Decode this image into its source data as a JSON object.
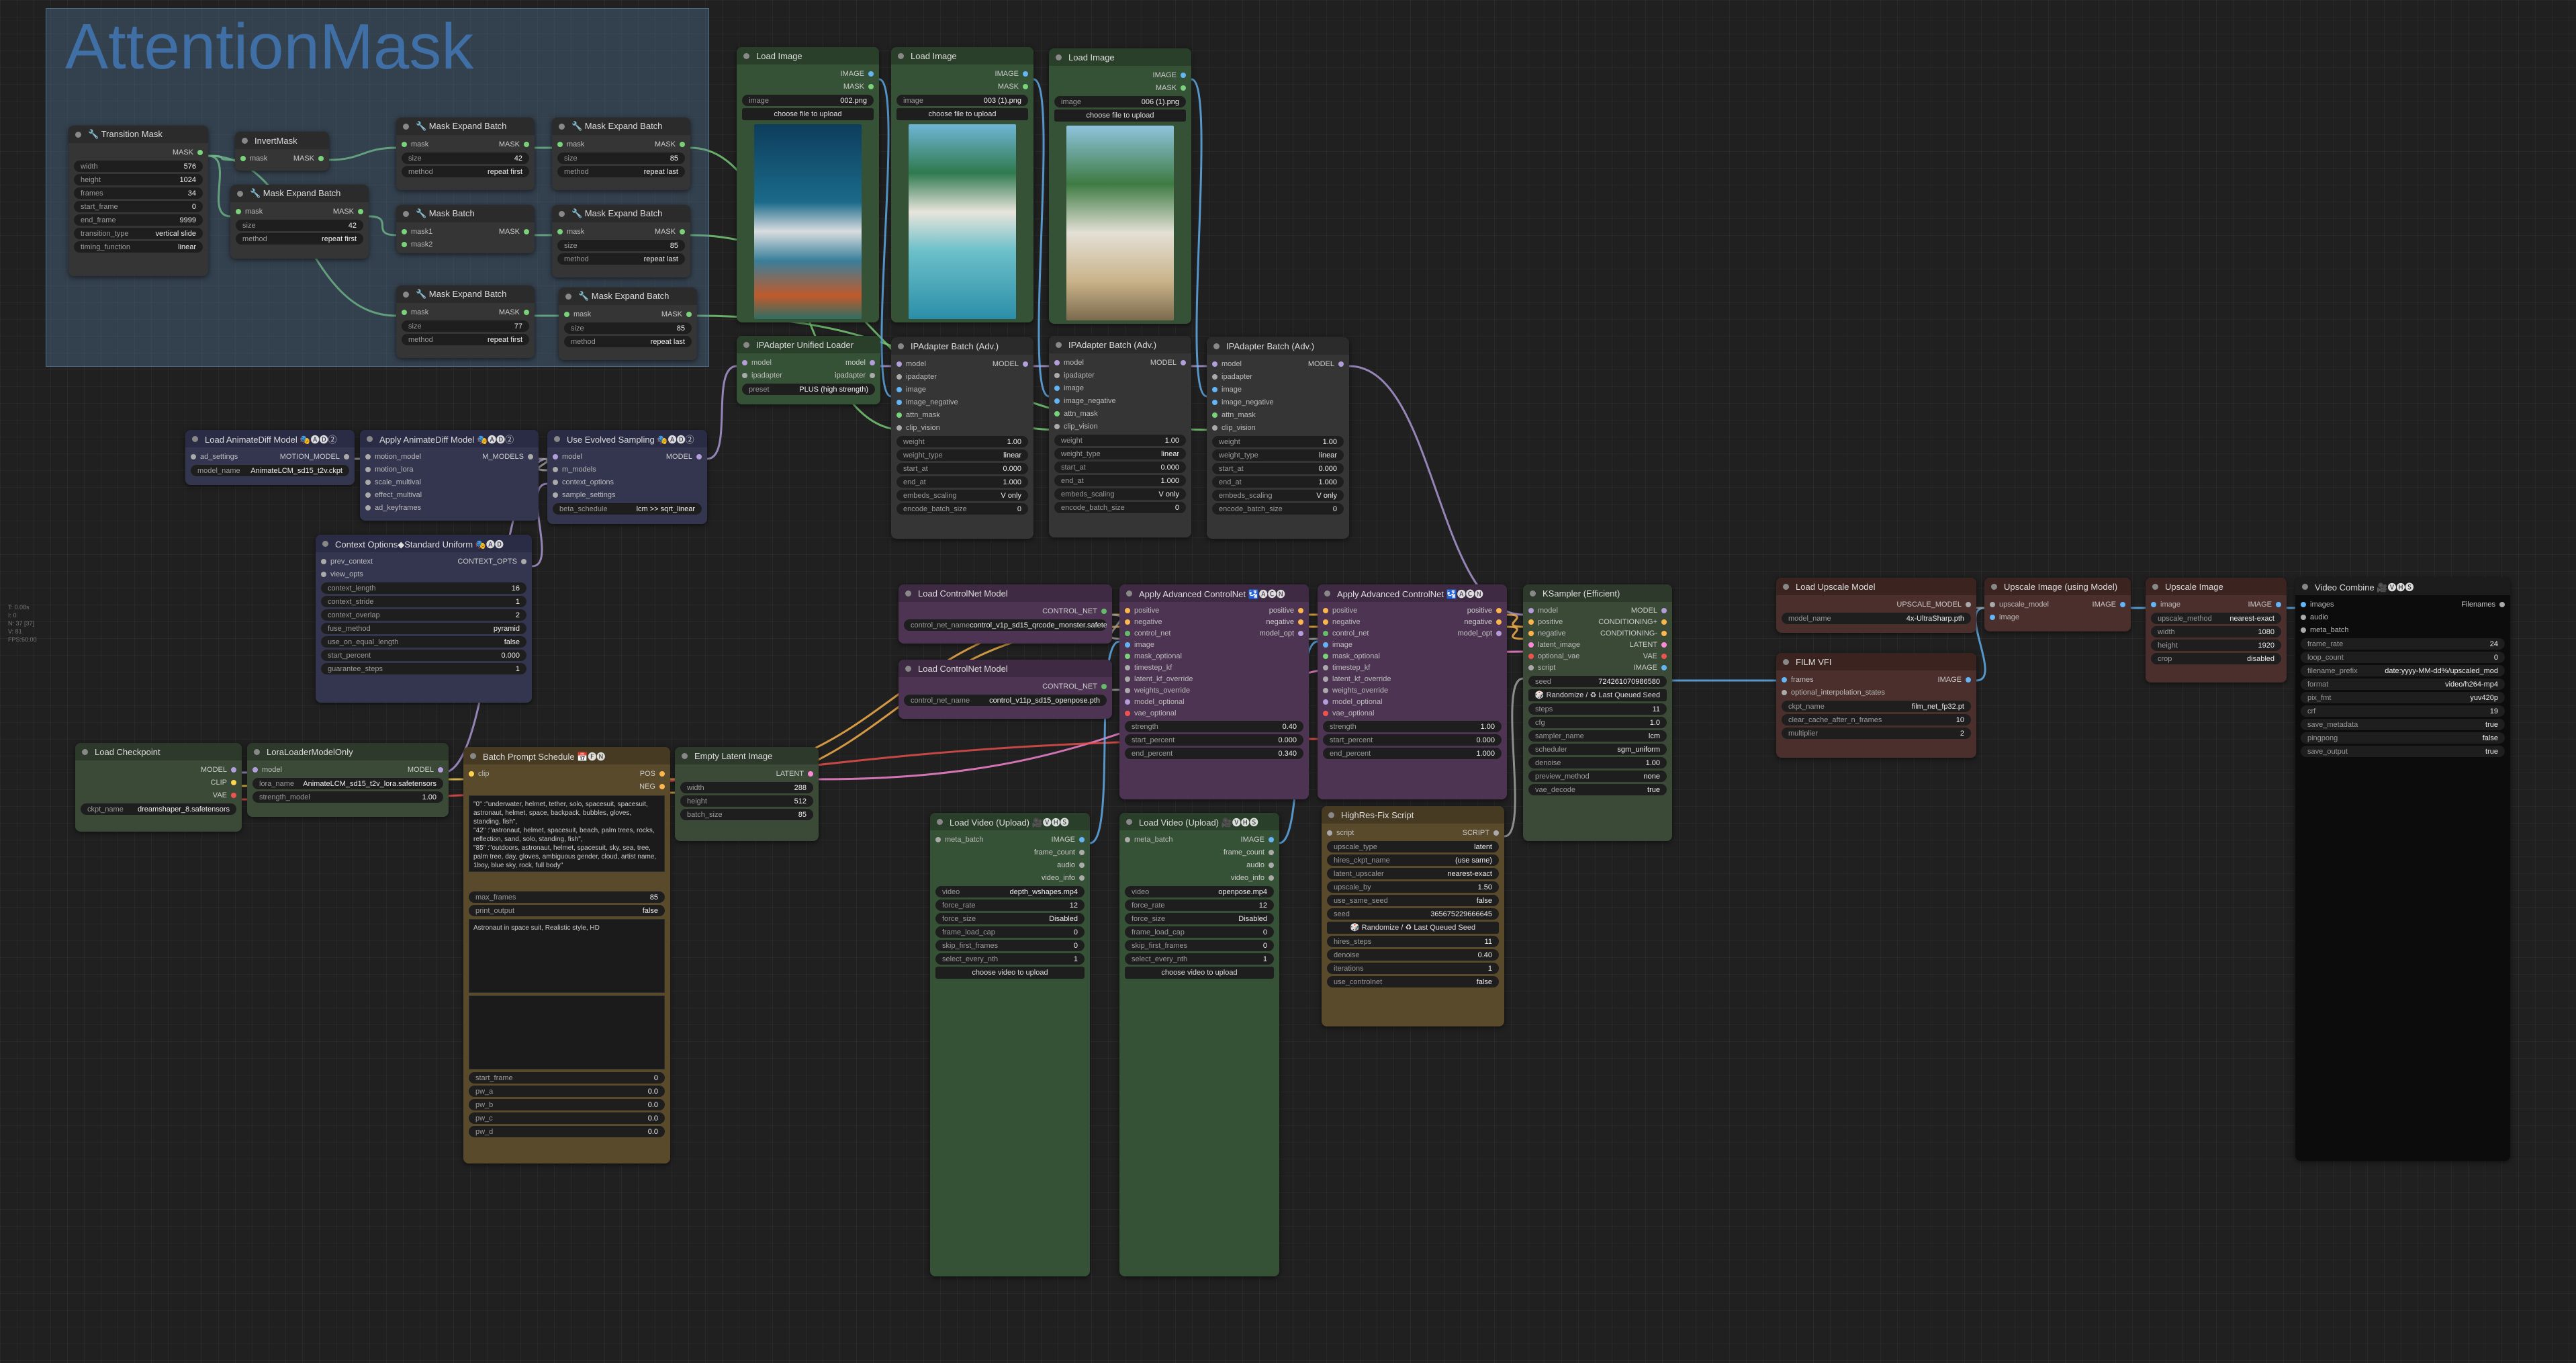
{
  "group": {
    "title": "AttentionMask"
  },
  "colors": {
    "mask_link": "#7ad27a",
    "model_link": "#b39ddb",
    "image_link": "#64b5f6",
    "cond_link": "#ffb74d",
    "latent_link": "#ff8ad8",
    "clip_link": "#ffd54f",
    "vae_link": "#ef5350"
  },
  "nodes": {
    "transition_mask": {
      "title": "🔧 Transition Mask",
      "out": "MASK",
      "w": [
        [
          "width",
          "576"
        ],
        [
          "height",
          "1024"
        ],
        [
          "frames",
          "34"
        ],
        [
          "start_frame",
          "0"
        ],
        [
          "end_frame",
          "9999"
        ],
        [
          "transition_type",
          "vertical slide"
        ],
        [
          "timing_function",
          "linear"
        ]
      ]
    },
    "invert_mask": {
      "title": "InvertMask",
      "in": "mask",
      "out": "MASK"
    },
    "meb_mid": {
      "title": "🔧 Mask Expand Batch",
      "in": "mask",
      "out": "MASK",
      "w": [
        [
          "size",
          "42"
        ],
        [
          "method",
          "repeat first"
        ]
      ]
    },
    "meb_1": {
      "title": "🔧 Mask Expand Batch",
      "in": "mask",
      "out": "MASK",
      "w": [
        [
          "size",
          "42"
        ],
        [
          "method",
          "repeat first"
        ]
      ]
    },
    "meb_2": {
      "title": "🔧 Mask Expand Batch",
      "in": "mask",
      "out": "MASK",
      "w": [
        [
          "size",
          "85"
        ],
        [
          "method",
          "repeat last"
        ]
      ]
    },
    "mask_batch": {
      "title": "🔧 Mask Batch",
      "in1": "mask1",
      "in2": "mask2",
      "out": "MASK"
    },
    "meb_3": {
      "title": "🔧 Mask Expand Batch",
      "in": "mask",
      "out": "MASK",
      "w": [
        [
          "size",
          "85"
        ],
        [
          "method",
          "repeat last"
        ]
      ]
    },
    "meb_4": {
      "title": "🔧 Mask Expand Batch",
      "in": "mask",
      "out": "MASK",
      "w": [
        [
          "size",
          "77"
        ],
        [
          "method",
          "repeat first"
        ]
      ]
    },
    "meb_5": {
      "title": "🔧 Mask Expand Batch",
      "in": "mask",
      "out": "MASK",
      "w": [
        [
          "size",
          "85"
        ],
        [
          "method",
          "repeat last"
        ]
      ]
    },
    "load_image_1": {
      "title": "Load Image",
      "o1": "IMAGE",
      "o2": "MASK",
      "image": "002.png",
      "upload": "choose file to upload"
    },
    "load_image_2": {
      "title": "Load Image",
      "o1": "IMAGE",
      "o2": "MASK",
      "image": "003 (1).png",
      "upload": "choose file to upload"
    },
    "load_image_3": {
      "title": "Load Image",
      "o1": "IMAGE",
      "o2": "MASK",
      "image": "006 (1).png",
      "upload": "choose file to upload"
    },
    "ipa_loader": {
      "title": "IPAdapter Unified Loader",
      "in1": "model",
      "in2": "ipadapter",
      "o1": "model",
      "o2": "ipadapter",
      "w": [
        [
          "preset",
          "PLUS (high strength)"
        ]
      ]
    },
    "ipa_batch": {
      "title": "IPAdapter Batch (Adv.)",
      "ins": [
        "model",
        "ipadapter",
        "image",
        "image_negative",
        "attn_mask",
        "clip_vision"
      ],
      "out": "MODEL",
      "w": [
        [
          "weight",
          "1.00"
        ],
        [
          "weight_type",
          "linear"
        ],
        [
          "start_at",
          "0.000"
        ],
        [
          "end_at",
          "1.000"
        ],
        [
          "embeds_scaling",
          "V only"
        ],
        [
          "encode_batch_size",
          "0"
        ]
      ]
    },
    "load_animatediff": {
      "title": "Load AnimateDiff Model 🎭🅐🅓②",
      "in": "ad_settings",
      "out": "MOTION_MODEL",
      "w": [
        [
          "model_name",
          "AnimateLCM_sd15_t2v.ckpt"
        ]
      ]
    },
    "apply_animatediff": {
      "title": "Apply AnimateDiff Model 🎭🅐🅓②",
      "ins": [
        "motion_model",
        "motion_lora",
        "scale_multival",
        "effect_multival",
        "ad_keyframes"
      ],
      "out": "M_MODELS"
    },
    "evolved_sampling": {
      "title": "Use Evolved Sampling 🎭🅐🅓②",
      "ins": [
        "model",
        "m_models",
        "context_options",
        "sample_settings"
      ],
      "out": "MODEL",
      "w": [
        [
          "beta_schedule",
          "lcm >> sqrt_linear"
        ]
      ]
    },
    "context_options": {
      "title": "Context Options◆Standard Uniform 🎭🅐🅓",
      "ins": [
        "prev_context",
        "view_opts"
      ],
      "out": "CONTEXT_OPTS",
      "w": [
        [
          "context_length",
          "16"
        ],
        [
          "context_stride",
          "1"
        ],
        [
          "context_overlap",
          "2"
        ],
        [
          "fuse_method",
          "pyramid"
        ],
        [
          "use_on_equal_length",
          "false"
        ],
        [
          "start_percent",
          "0.000"
        ],
        [
          "guarantee_steps",
          "1"
        ]
      ]
    },
    "load_checkpoint": {
      "title": "Load Checkpoint",
      "outs": [
        "MODEL",
        "CLIP",
        "VAE"
      ],
      "w": [
        [
          "ckpt_name",
          "dreamshaper_8.safetensors"
        ]
      ]
    },
    "lora_loader": {
      "title": "LoraLoaderModelOnly",
      "in": "model",
      "out": "MODEL",
      "w": [
        [
          "lora_name",
          "AnimateLCM_sd15_t2v_lora.safetensors"
        ],
        [
          "strength_model",
          "1.00"
        ]
      ]
    },
    "batch_prompt": {
      "title": "Batch Prompt Schedule 📅🅕🅝",
      "in": "clip",
      "o1": "POS",
      "o2": "NEG",
      "text": "\"0\" :\"underwater, helmet, tether, solo, spacesuit, spacesuit, astronaut, helmet, space, backpack, bubbles, gloves, standing, fish\",\n\"42\" :\"astronaut, helmet, spacesuit, beach, palm trees, rocks, reflection, sand, solo, standing, fish\",\n\"85\" :\"outdoors, astronaut, helmet, spacesuit, sky, sea, tree, palm tree, day, gloves, ambiguous gender, cloud, artist name, 1boy, blue sky, rock, full body\"",
      "w1": [
        [
          "max_frames",
          "85"
        ],
        [
          "print_output",
          "false"
        ]
      ],
      "pre_text": "Astronaut in space suit, Realistic style, HD",
      "w2": [
        [
          "start_frame",
          "0"
        ],
        [
          "pw_a",
          "0.0"
        ],
        [
          "pw_b",
          "0.0"
        ],
        [
          "pw_c",
          "0.0"
        ],
        [
          "pw_d",
          "0.0"
        ]
      ]
    },
    "empty_latent": {
      "title": "Empty Latent Image",
      "out": "LATENT",
      "w": [
        [
          "width",
          "288"
        ],
        [
          "height",
          "512"
        ],
        [
          "batch_size",
          "85"
        ]
      ]
    },
    "cn_loader_1": {
      "title": "Load ControlNet Model",
      "out": "CONTROL_NET",
      "w": [
        [
          "control_net_name",
          "control_v1p_sd15_qrcode_monster.safetensors"
        ]
      ]
    },
    "cn_loader_2": {
      "title": "Load ControlNet Model",
      "out": "CONTROL_NET",
      "w": [
        [
          "control_net_name",
          "control_v11p_sd15_openpose.pth"
        ]
      ]
    },
    "adv_cn_1": {
      "title": "Apply Advanced ControlNet 🛂🅐🅒🅝",
      "ins": [
        "positive",
        "negative",
        "control_net",
        "image",
        "mask_optional",
        "timestep_kf",
        "latent_kf_override",
        "weights_override",
        "model_optional",
        "vae_optional"
      ],
      "outs": [
        "positive",
        "negative",
        "model_opt"
      ],
      "w": [
        [
          "strength",
          "0.40"
        ],
        [
          "start_percent",
          "0.000"
        ],
        [
          "end_percent",
          "0.340"
        ]
      ]
    },
    "adv_cn_2": {
      "title": "Apply Advanced ControlNet 🛂🅐🅒🅝",
      "ins": [
        "positive",
        "negative",
        "control_net",
        "image",
        "mask_optional",
        "timestep_kf",
        "latent_kf_override",
        "weights_override",
        "model_optional",
        "vae_optional"
      ],
      "outs": [
        "positive",
        "negative",
        "model_opt"
      ],
      "w": [
        [
          "strength",
          "1.00"
        ],
        [
          "start_percent",
          "0.000"
        ],
        [
          "end_percent",
          "1.000"
        ]
      ]
    },
    "ksampler": {
      "title": "KSampler (Efficient)",
      "ins": [
        "model",
        "positive",
        "negative",
        "latent_image",
        "optional_vae",
        "script"
      ],
      "outs": [
        "MODEL",
        "CONDITIONING+",
        "CONDITIONING-",
        "LATENT",
        "VAE",
        "IMAGE"
      ],
      "seed": [
        "seed",
        "724261070986580"
      ],
      "seed_btn": "🎲 Randomize / ♻ Last Queued Seed",
      "w": [
        [
          "steps",
          "11"
        ],
        [
          "cfg",
          "1.0"
        ],
        [
          "sampler_name",
          "lcm"
        ],
        [
          "scheduler",
          "sgm_uniform"
        ],
        [
          "denoise",
          "1.00"
        ],
        [
          "preview_method",
          "none"
        ],
        [
          "vae_decode",
          "true"
        ]
      ]
    },
    "video_1": {
      "title": "Load Video (Upload) 🎥🅥🅗🅢",
      "in": "meta_batch",
      "outs": [
        "IMAGE",
        "frame_count",
        "audio",
        "video_info"
      ],
      "w": [
        [
          "video",
          "depth_wshapes.mp4"
        ],
        [
          "force_rate",
          "12"
        ],
        [
          "force_size",
          "Disabled"
        ],
        [
          "frame_load_cap",
          "0"
        ],
        [
          "skip_first_frames",
          "0"
        ],
        [
          "select_every_nth",
          "1"
        ]
      ],
      "upload": "choose video to upload"
    },
    "video_2": {
      "title": "Load Video (Upload) 🎥🅥🅗🅢",
      "in": "meta_batch",
      "outs": [
        "IMAGE",
        "frame_count",
        "audio",
        "video_info"
      ],
      "w": [
        [
          "video",
          "openpose.mp4"
        ],
        [
          "force_rate",
          "12"
        ],
        [
          "force_size",
          "Disabled"
        ],
        [
          "frame_load_cap",
          "0"
        ],
        [
          "skip_first_frames",
          "0"
        ],
        [
          "select_every_nth",
          "1"
        ]
      ],
      "upload": "choose video to upload"
    },
    "hires": {
      "title": "HighRes-Fix Script",
      "in": "script",
      "out": "SCRIPT",
      "w1": [
        [
          "upscale_type",
          "latent"
        ],
        [
          "hires_ckpt_name",
          "(use same)"
        ],
        [
          "latent_upscaler",
          "nearest-exact"
        ],
        [
          "upscale_by",
          "1.50"
        ],
        [
          "use_same_seed",
          "false"
        ],
        [
          "seed",
          "365675229666645"
        ]
      ],
      "seed_btn": "🎲 Randomize / ♻ Last Queued Seed",
      "w2": [
        [
          "hires_steps",
          "11"
        ],
        [
          "denoise",
          "0.40"
        ],
        [
          "iterations",
          "1"
        ],
        [
          "use_controlnet",
          "false"
        ]
      ]
    },
    "load_upscale": {
      "title": "Load Upscale Model",
      "out": "UPSCALE_MODEL",
      "w": [
        [
          "model_name",
          "4x-UltraSharp.pth"
        ]
      ]
    },
    "upscale_using": {
      "title": "Upscale Image (using Model)",
      "ins": [
        "upscale_model",
        "image"
      ],
      "out": "IMAGE"
    },
    "upscale_image": {
      "title": "Upscale Image",
      "in": "image",
      "out": "IMAGE",
      "w": [
        [
          "upscale_method",
          "nearest-exact"
        ],
        [
          "width",
          "1080"
        ],
        [
          "height",
          "1920"
        ],
        [
          "crop",
          "disabled"
        ]
      ]
    },
    "film_vfi": {
      "title": "FILM VFI",
      "ins": [
        "frames",
        "optional_interpolation_states"
      ],
      "out": "IMAGE",
      "w": [
        [
          "ckpt_name",
          "film_net_fp32.pt"
        ],
        [
          "clear_cache_after_n_frames",
          "10"
        ],
        [
          "multiplier",
          "2"
        ]
      ]
    },
    "video_combine": {
      "title": "Video Combine 🎥🅥🅗🅢",
      "ins": [
        "images",
        "audio",
        "meta_batch"
      ],
      "out": "Filenames",
      "w": [
        [
          "frame_rate",
          "24"
        ],
        [
          "loop_count",
          "0"
        ],
        [
          "filename_prefix",
          "date:yyyy-MM-dd%/upscaled_mod"
        ],
        [
          "format",
          "video/h264-mp4"
        ],
        [
          "pix_fmt",
          "yuv420p"
        ],
        [
          "crf",
          "19"
        ],
        [
          "save_metadata",
          "true"
        ],
        [
          "pingpong",
          "false"
        ],
        [
          "save_output",
          "true"
        ]
      ]
    }
  },
  "side_info": [
    "T: 0.08s",
    "I: 0",
    "N: 37 [37]",
    "V: 81",
    "FPS:60.00"
  ]
}
